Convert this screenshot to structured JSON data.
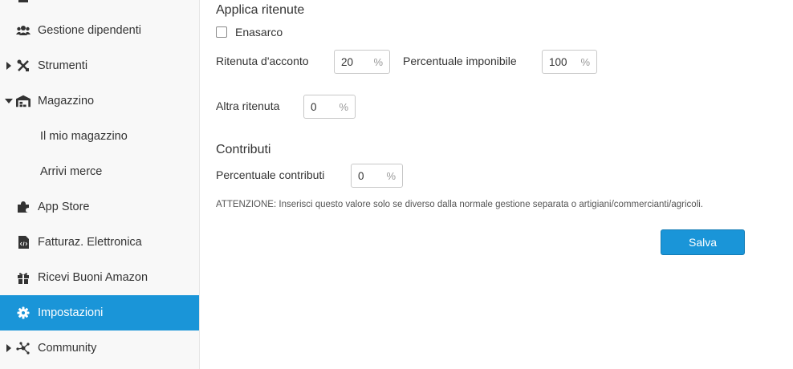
{
  "sidebar": {
    "items": [
      {
        "label": "Gestione dipendenti",
        "icon": "users-icon"
      },
      {
        "label": "Strumenti",
        "icon": "tools-icon"
      },
      {
        "label": "Magazzino",
        "icon": "warehouse-icon"
      },
      {
        "label": "Il mio magazzino"
      },
      {
        "label": "Arrivi merce"
      },
      {
        "label": "App Store",
        "icon": "puzzle-icon"
      },
      {
        "label": "Fatturaz. Elettronica",
        "icon": "code-file-icon"
      },
      {
        "label": "Ricevi Buoni Amazon",
        "icon": "gift-icon"
      },
      {
        "label": "Impostazioni",
        "icon": "gear-icon"
      },
      {
        "label": "Community",
        "icon": "network-icon"
      }
    ]
  },
  "main": {
    "ritenute_title": "Applica ritenute",
    "enasarco_label": "Enasarco",
    "ritenuta_acconto_label": "Ritenuta d'acconto",
    "ritenuta_acconto_value": "20",
    "percentuale_imponibile_label": "Percentuale imponibile",
    "percentuale_imponibile_value": "100",
    "altra_ritenuta_label": "Altra ritenuta",
    "altra_ritenuta_value": "0",
    "contributi_title": "Contributi",
    "percentuale_contributi_label": "Percentuale contributi",
    "percentuale_contributi_value": "0",
    "percent_unit": "%",
    "note": "ATTENZIONE: Inserisci questo valore solo se diverso dalla normale gestione separata o artigiani/commercianti/agricoli.",
    "save_label": "Salva"
  },
  "colors": {
    "accent": "#1a95d8",
    "sidebar_bg": "#f8f8f8"
  }
}
